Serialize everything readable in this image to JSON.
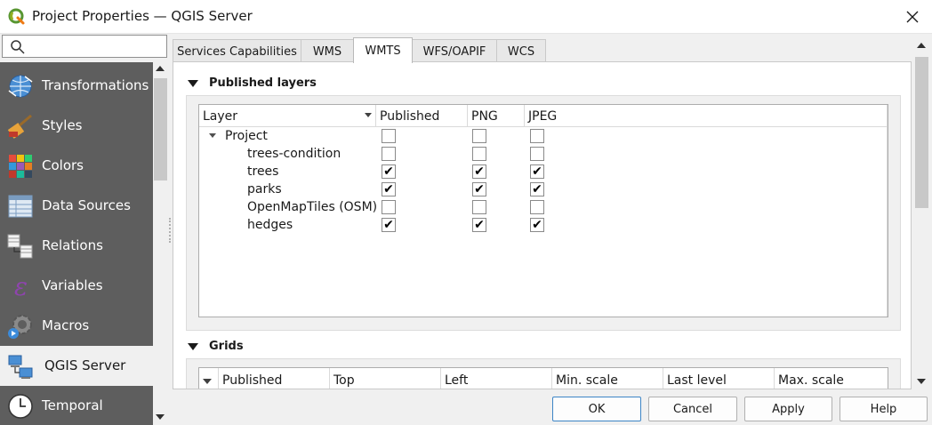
{
  "window": {
    "title": "Project Properties — QGIS Server",
    "app_icon": "qgis-icon",
    "close_icon": "close-icon"
  },
  "sidebar": {
    "search": {
      "placeholder": "",
      "value": "",
      "icon": "search-icon"
    },
    "items": [
      {
        "label": "Transformations",
        "icon": "globe-transform-icon"
      },
      {
        "label": "Styles",
        "icon": "paintbrush-icon"
      },
      {
        "label": "Colors",
        "icon": "color-grid-icon"
      },
      {
        "label": "Data Sources",
        "icon": "data-table-icon"
      },
      {
        "label": "Relations",
        "icon": "relations-icon"
      },
      {
        "label": "Variables",
        "icon": "epsilon-icon"
      },
      {
        "label": "Macros",
        "icon": "gear-play-icon"
      },
      {
        "label": "QGIS Server",
        "icon": "server-icon",
        "selected": true
      },
      {
        "label": "Temporal",
        "icon": "clock-icon"
      }
    ]
  },
  "tabs": [
    {
      "label": "Services Capabilities"
    },
    {
      "label": "WMS"
    },
    {
      "label": "WMTS",
      "active": true
    },
    {
      "label": "WFS/OAPIF"
    },
    {
      "label": "WCS"
    }
  ],
  "published_layers": {
    "title": "Published layers",
    "columns": [
      "Layer",
      "Published",
      "PNG",
      "JPEG"
    ],
    "rows": [
      {
        "name": "Project",
        "published": false,
        "png": false,
        "jpeg": false,
        "is_group": true
      },
      {
        "name": "trees-condition",
        "published": false,
        "png": false,
        "jpeg": false
      },
      {
        "name": "trees",
        "published": true,
        "png": true,
        "jpeg": true
      },
      {
        "name": "parks",
        "published": true,
        "png": true,
        "jpeg": true
      },
      {
        "name": "OpenMapTiles (OSM)",
        "published": false,
        "png": false,
        "jpeg": false
      },
      {
        "name": "hedges",
        "published": true,
        "png": true,
        "jpeg": true
      }
    ]
  },
  "grids": {
    "title": "Grids",
    "columns": [
      "Published",
      "Top",
      "Left",
      "Min. scale",
      "Last level",
      "Max. scale"
    ]
  },
  "buttons": {
    "ok": "OK",
    "cancel": "Cancel",
    "apply": "Apply",
    "help": "Help"
  },
  "colors": {
    "sidebar_bg": "#5e5e5e",
    "accent": "#3d85c6"
  }
}
